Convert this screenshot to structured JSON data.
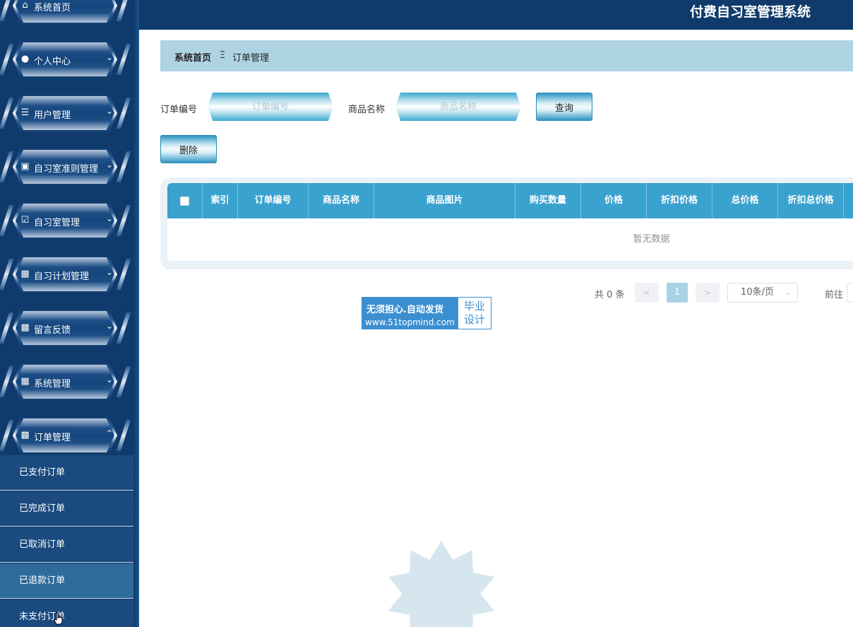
{
  "header": {
    "title": "付费自习室管理系统"
  },
  "sidebar": {
    "items": [
      {
        "label": "系统首页",
        "icon": "home-icon",
        "expandable": false
      },
      {
        "label": "个人中心",
        "icon": "user-icon",
        "expandable": true
      },
      {
        "label": "用户管理",
        "icon": "list-icon",
        "expandable": true
      },
      {
        "label": "自习室准则管理",
        "icon": "wallet-icon",
        "expandable": true
      },
      {
        "label": "自习室管理",
        "icon": "clipboard-icon",
        "expandable": true
      },
      {
        "label": "自习计划管理",
        "icon": "grid-icon",
        "expandable": true
      },
      {
        "label": "留言反馈",
        "icon": "apps-icon",
        "expandable": true
      },
      {
        "label": "系统管理",
        "icon": "grid-icon",
        "expandable": true
      },
      {
        "label": "订单管理",
        "icon": "monitor-icon",
        "expandable": true,
        "expanded": true
      }
    ],
    "subitems": [
      {
        "label": "已支付订单"
      },
      {
        "label": "已完成订单"
      },
      {
        "label": "已取消订单"
      },
      {
        "label": "已退款订单",
        "active": true
      },
      {
        "label": "未支付订单"
      }
    ]
  },
  "breadcrumb": {
    "home": "系统首页",
    "separator": "Ξ",
    "current": "订单管理"
  },
  "search": {
    "order_no_label": "订单编号",
    "order_no_placeholder": "订单编号",
    "product_label": "商品名称",
    "product_placeholder": "商品名称",
    "query_label": "查询"
  },
  "actions": {
    "delete_label": "删除"
  },
  "table": {
    "columns": [
      "索引",
      "订单编号",
      "商品名称",
      "商品图片",
      "购买数量",
      "价格",
      "折扣价格",
      "总价格",
      "折扣总价格"
    ],
    "empty_text": "暂无数据"
  },
  "pagination": {
    "total_text": "共 0 条",
    "prev": "<",
    "next": ">",
    "current_page": "1",
    "page_size": "10条/页",
    "goto_label": "前往"
  },
  "badge": {
    "line1": "无须担心.自动发货",
    "line2": "www.51topmind.com",
    "right_line1": "毕业",
    "right_line2": "设计"
  },
  "colors": {
    "sidebar_bg": "#0f3a6b",
    "header_bg": "#0f3a6b",
    "table_header": "#3aa2cf",
    "breadcrumb_bg": "#aed4e4",
    "active_page": "#a8d3e6"
  }
}
